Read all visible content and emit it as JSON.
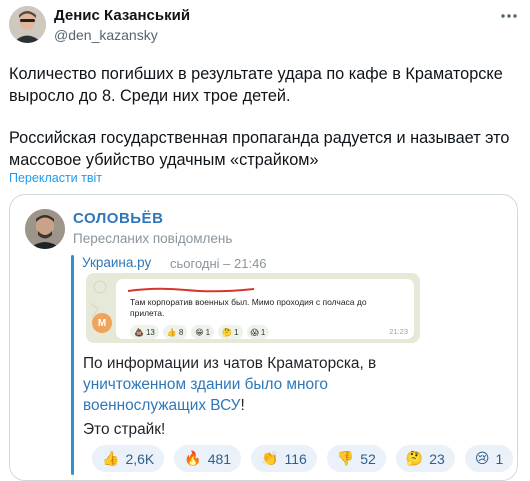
{
  "tweet": {
    "author_name": "Денис Казанський",
    "author_handle": "@den_kazansky",
    "more_icon": "more-horizontal-icon",
    "paragraph_1": "Количество погибших в результате удара по кафе в Краматорске\nвыросло до 8. Среди них трое детей.",
    "paragraph_2": "Российская государственная пропаганда радуется и называет это\nмассовое убийство удачным «страйком»",
    "translate_label": "Перекласти твіт"
  },
  "forwarded_post": {
    "channel_name": "СОЛОВЬЁВ",
    "forward_label": "Пересланих повідомлень",
    "source_name": "Украина.ру",
    "source_time": "сьогодні – 21:46",
    "embedded": {
      "text": "Там корпоратив военных был. Мимо проходия с полчаса до прилета.",
      "time": "21:23",
      "user_initial": "М",
      "reactions": [
        {
          "emoji": "💩",
          "count": "13"
        },
        {
          "emoji": "👍",
          "count": "8"
        },
        {
          "emoji": "😁",
          "count": "1"
        },
        {
          "emoji": "🤔",
          "count": "1"
        },
        {
          "emoji": "😱",
          "count": "1"
        }
      ]
    },
    "message_part_1": "По информации из чатов Краматорска, в ",
    "message_link": "уничтоженном здании было много военнослужащих ВСУ",
    "message_part_2": "!",
    "message_line_2": "Это страйк!",
    "reactions": [
      {
        "emoji": "👍",
        "count": "2,6K"
      },
      {
        "emoji": "🔥",
        "count": "481"
      },
      {
        "emoji": "👏",
        "count": "116"
      },
      {
        "emoji": "👎",
        "count": "52"
      },
      {
        "emoji": "🤔",
        "count": "23"
      },
      {
        "emoji": "😢",
        "count": "1"
      }
    ]
  },
  "colors": {
    "link_blue": "#1d9bf0",
    "telegram_blue": "#2f77b8",
    "secondary_text": "#536471"
  }
}
